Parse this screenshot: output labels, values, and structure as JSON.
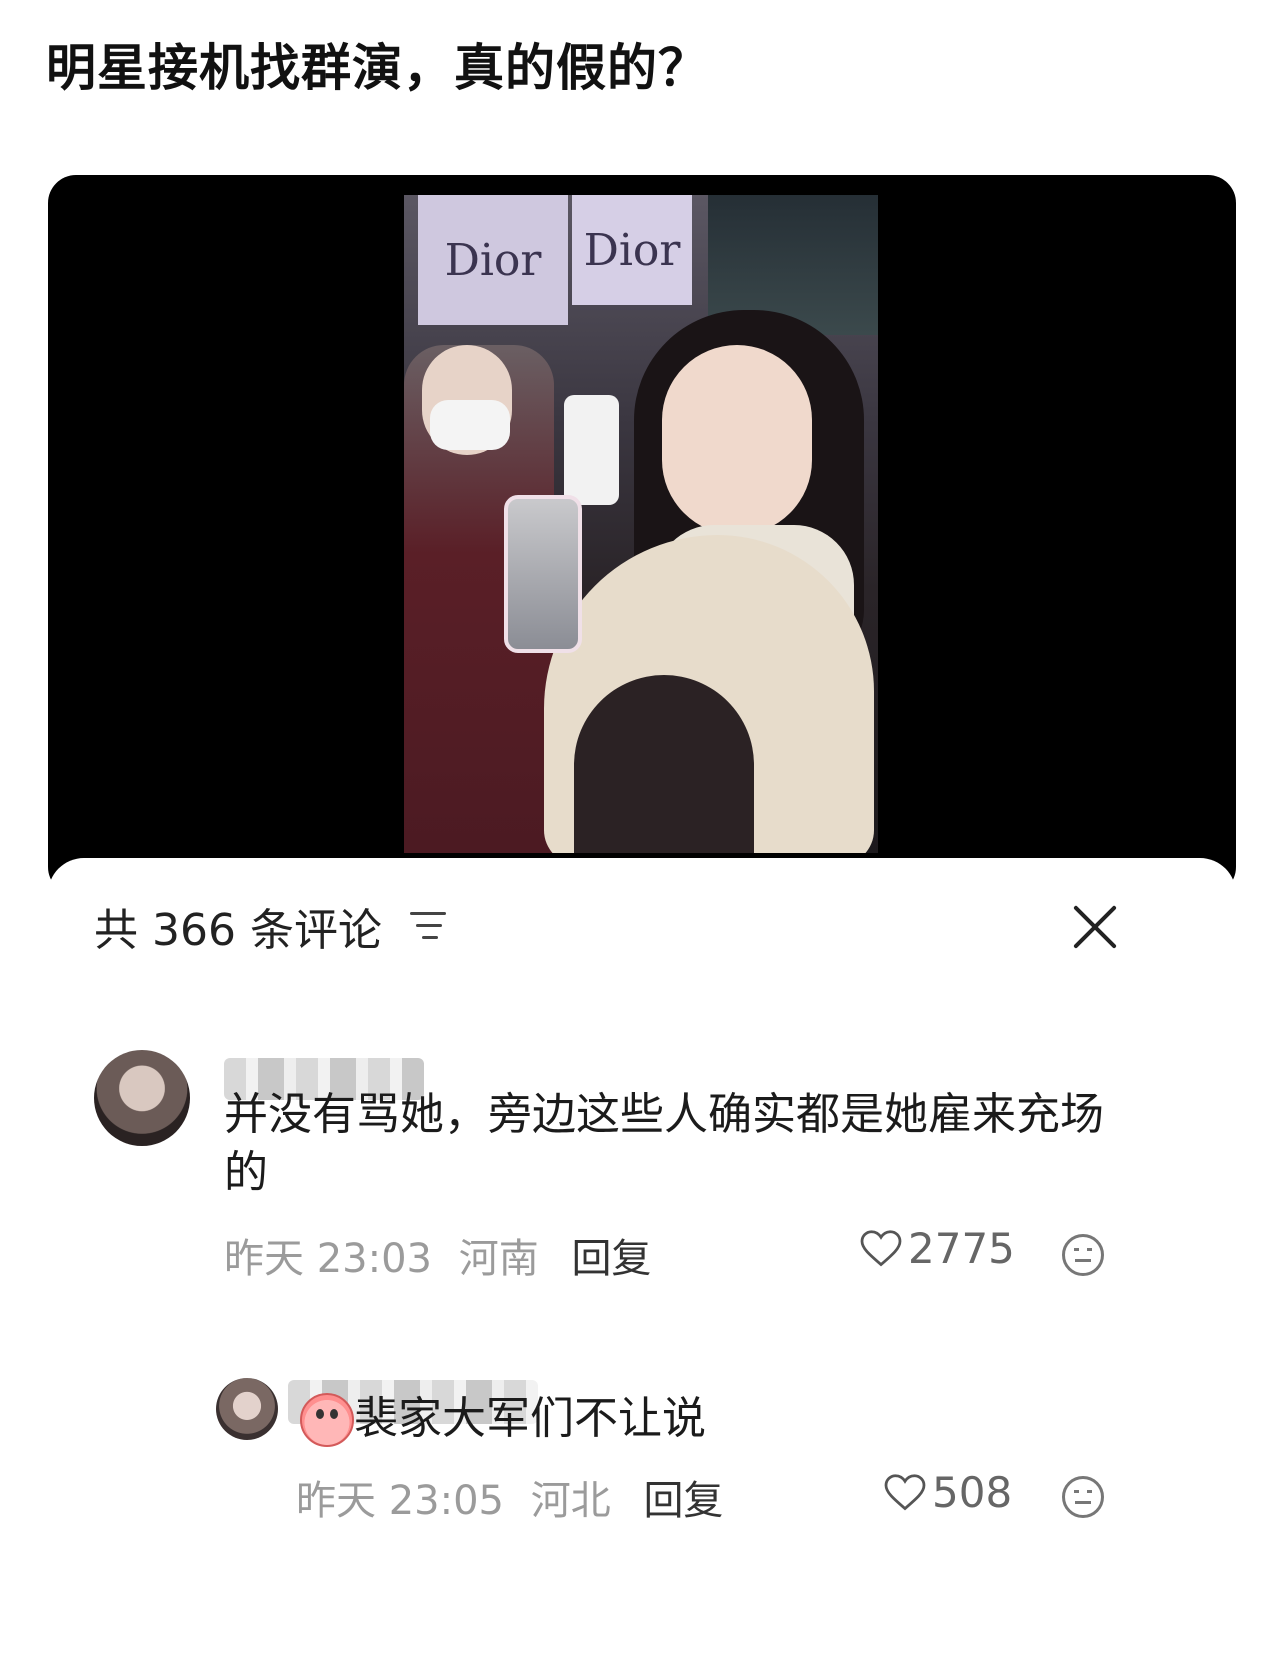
{
  "post": {
    "title": "明星接机找群演，真的假的？"
  },
  "video": {
    "sign_left_text": "Dior",
    "sign_right_text": "Dior"
  },
  "comments_panel": {
    "title": "共 366 条评论",
    "filter_icon": "filter-icon",
    "close_icon": "close-icon"
  },
  "comments": [
    {
      "text": "并没有骂她，旁边这些人确实都是她雇来充场的",
      "time": "昨天 23:03",
      "location": "河南",
      "reply_label": "回复",
      "likes": "2775"
    },
    {
      "text": "裴家大军们不让说",
      "time": "昨天 23:05",
      "location": "河北",
      "reply_label": "回复",
      "likes": "508"
    }
  ],
  "colors": {
    "video_bg": "#000000",
    "text_primary": "#222222",
    "meta_text": "#9b9b9b"
  }
}
